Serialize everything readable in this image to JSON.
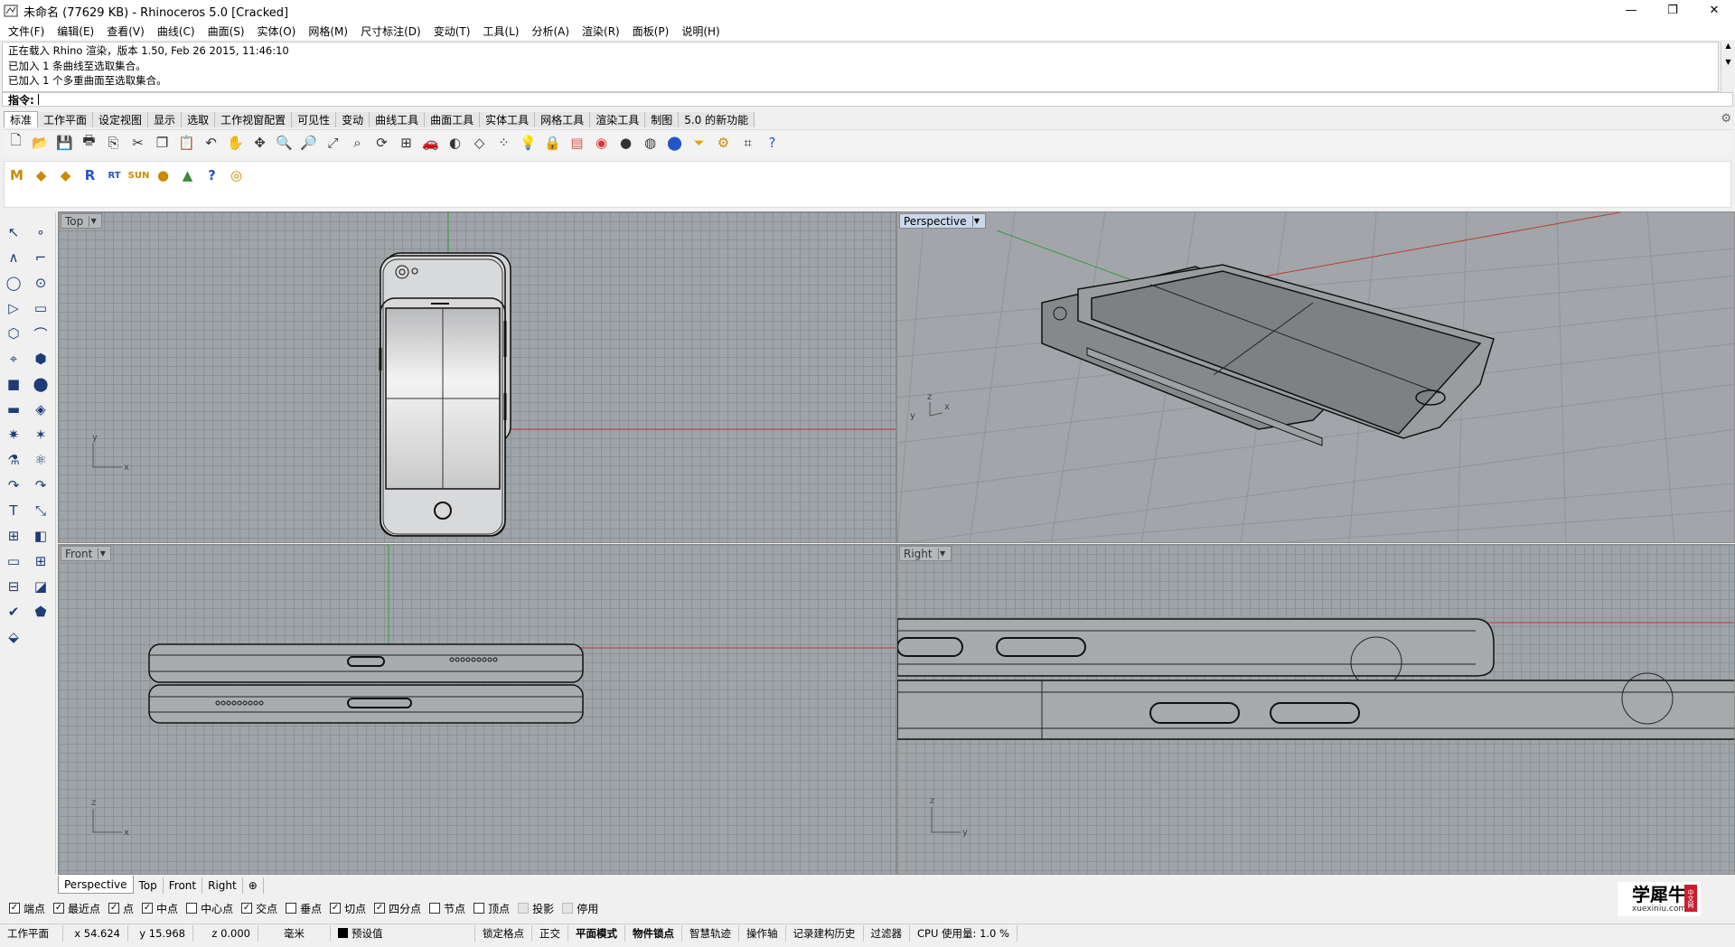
{
  "window": {
    "title": "未命名 (77629 KB) - Rhinoceros 5.0 [Cracked]",
    "controls": [
      "—",
      "❐",
      "✕"
    ]
  },
  "menu": [
    "文件(F)",
    "编辑(E)",
    "查看(V)",
    "曲线(C)",
    "曲面(S)",
    "实体(O)",
    "网格(M)",
    "尺寸标注(D)",
    "变动(T)",
    "工具(L)",
    "分析(A)",
    "渲染(R)",
    "面板(P)",
    "说明(H)"
  ],
  "history": [
    "正在载入 Rhino 渲染，版本 1.50, Feb 26 2015, 11:46:10",
    "已加入 1 条曲线至选取集合。",
    "已加入 1 个多重曲面至选取集合。"
  ],
  "command": {
    "label": "指令:",
    "value": ""
  },
  "toolbar_tabs": [
    "标准",
    "工作平面",
    "设定视图",
    "显示",
    "选取",
    "工作视窗配置",
    "可见性",
    "变动",
    "曲线工具",
    "曲面工具",
    "实体工具",
    "网格工具",
    "渲染工具",
    "制图",
    "5.0 的新功能"
  ],
  "active_tab": "标准",
  "toolbar_icons_row1": [
    "new-file",
    "open-folder",
    "save",
    "print",
    "import",
    "cut",
    "copy",
    "paste",
    "undo",
    "pan-hand",
    "move-view",
    "zoom-window",
    "zoom-dynamic",
    "zoom-extents",
    "zoom-selected",
    "rotate-view",
    "four-views",
    "car-render",
    "shade",
    "wireframe",
    "points",
    "light-bulb",
    "lock",
    "layer",
    "color-wheel",
    "material-ball",
    "render-sphere",
    "blue-sphere",
    "filter",
    "gear-tools",
    "snap-grid",
    "help"
  ],
  "toolbar_icons_row2": [
    "M",
    "◆",
    "◆",
    "R",
    "RT",
    "SUN",
    "●",
    "▲",
    "?",
    "◎"
  ],
  "viewports": {
    "top": {
      "label": "Top"
    },
    "perspective": {
      "label": "Perspective"
    },
    "front": {
      "label": "Front"
    },
    "right": {
      "label": "Right"
    }
  },
  "viewport_tabs": [
    "Perspective",
    "Top",
    "Front",
    "Right",
    "⊕"
  ],
  "osnaps": [
    {
      "label": "端点",
      "checked": true
    },
    {
      "label": "最近点",
      "checked": true
    },
    {
      "label": "点",
      "checked": true
    },
    {
      "label": "中点",
      "checked": true
    },
    {
      "label": "中心点",
      "checked": false
    },
    {
      "label": "交点",
      "checked": true
    },
    {
      "label": "垂点",
      "checked": false
    },
    {
      "label": "切点",
      "checked": true
    },
    {
      "label": "四分点",
      "checked": true
    },
    {
      "label": "节点",
      "checked": false
    },
    {
      "label": "顶点",
      "checked": false
    },
    {
      "label": "投影",
      "checked": false,
      "disabled": true
    },
    {
      "label": "停用",
      "checked": false,
      "disabled": true
    }
  ],
  "status": {
    "cplane": "工作平面",
    "x": "x 54.624",
    "y": "y 15.968",
    "z": "z 0.000",
    "unit": "毫米",
    "layer": "预设值",
    "grid_snap": "锁定格点",
    "ortho": "正交",
    "planar": "平面模式",
    "osnap": "物件锁点",
    "smarttrack": "智慧轨迹",
    "gumball": "操作轴",
    "history": "记录建构历史",
    "filter": "过滤器",
    "cpu": "CPU 使用量: 1.0 %"
  },
  "watermark": {
    "big": "学犀牛",
    "small": "xuexiniu.com",
    "stamp": "中文网"
  },
  "colors": {
    "grid_bg": "#9fa4a9",
    "x_axis": "#c0392b",
    "y_axis": "#2e9e3c",
    "active_view_label": "#c9d8ec"
  }
}
